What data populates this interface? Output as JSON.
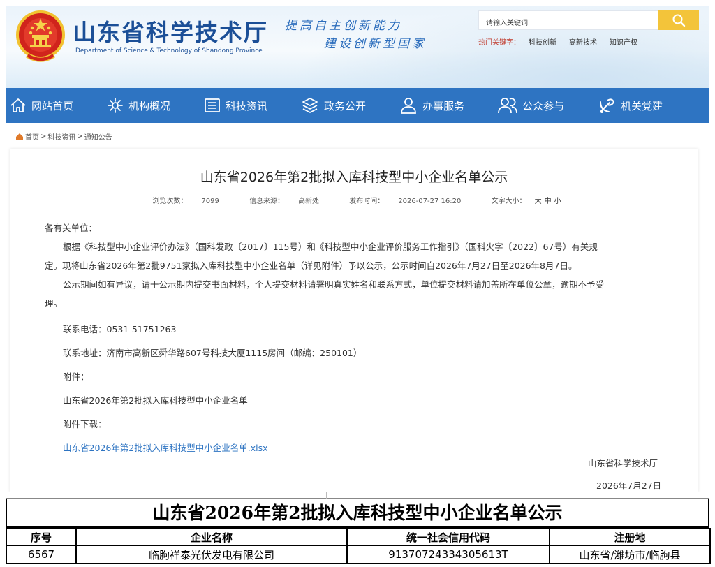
{
  "header": {
    "site_title": "山东省科学技术厅",
    "site_subtitle": "Department of Science & Technology of Shandong Province",
    "slogan_line1": "提高自主创新能力",
    "slogan_line2": "建设创新型国家",
    "search": {
      "placeholder": "请输入关键词"
    },
    "hot_label": "热门关键字：",
    "hot_keywords": [
      "科技创新",
      "高新技术",
      "知识产权"
    ]
  },
  "nav": {
    "items": [
      {
        "label": "网站首页",
        "icon": "home-icon"
      },
      {
        "label": "机构概况",
        "icon": "settings-icon"
      },
      {
        "label": "科技资讯",
        "icon": "news-icon"
      },
      {
        "label": "政务公开",
        "icon": "layers-icon"
      },
      {
        "label": "办事服务",
        "icon": "user-icon"
      },
      {
        "label": "公众参与",
        "icon": "group-icon"
      },
      {
        "label": "机关党建",
        "icon": "party-icon"
      }
    ]
  },
  "breadcrumb": {
    "items": [
      "首页",
      "科技资讯",
      "通知公告"
    ],
    "separator": ">"
  },
  "article": {
    "title": "山东省2026年第2批拟入库科技型中小企业名单公示",
    "meta": {
      "views_label": "浏览次数：",
      "views": "7099",
      "source_label": "信息来源：",
      "source": "高新处",
      "time_label": "发布时间：",
      "time": "2026-07-27 16:20",
      "size_label": "文字大小：",
      "sizes": [
        "大",
        "中",
        "小"
      ]
    },
    "greeting": "各有关单位：",
    "para1_line1": "根据《科技型中小企业评价办法》（国科发政〔2017〕115号）和《科技型中小企业评价服务工作指引》（国科火字〔2022〕67号）有关规",
    "para1_line2": "定。现将山东省2026年第2批9751家拟入库科技型中小企业名单（详见附件）予以公示，公示时间自2026年7月27日至2026年8月7日。",
    "para2_line1": "公示期间如有异议，请于公示期内提交书面材料，个人提交材料请署明真实姓名和联系方式，单位提交材料请加盖所在单位公章，逾期不予受",
    "para2_line2": "理。",
    "phone": "联系电话：0531-51751263",
    "address": "联系地址：济南市高新区舜华路607号科技大厦1115房间（邮编：250101）",
    "attachment_label": "附件：",
    "attachment_name": "山东省2026年第2批拟入库科技型中小企业名单",
    "download_label": "附件下载：",
    "download_link": "山东省2026年第2批拟入库科技型中小企业名单.xlsx",
    "signature": "山东省科学技术厅",
    "date": "2026年7月27日"
  },
  "sheet": {
    "title": "山东省2026年第2批拟入库科技型中小企业名单公示",
    "columns": [
      "序号",
      "企业名称",
      "统一社会信用代码",
      "注册地"
    ],
    "rows": [
      [
        "6567",
        "临朐祥泰光伏发电有限公司",
        "91370724334305613T",
        "山东省/潍坊市/临朐县"
      ]
    ]
  },
  "colors": {
    "brand_blue": "#1b4f97",
    "nav_blue": "#2e74c2",
    "search_button": "#f3c43a",
    "hot_label": "#c0392b",
    "emblem_red": "#d0241c"
  }
}
